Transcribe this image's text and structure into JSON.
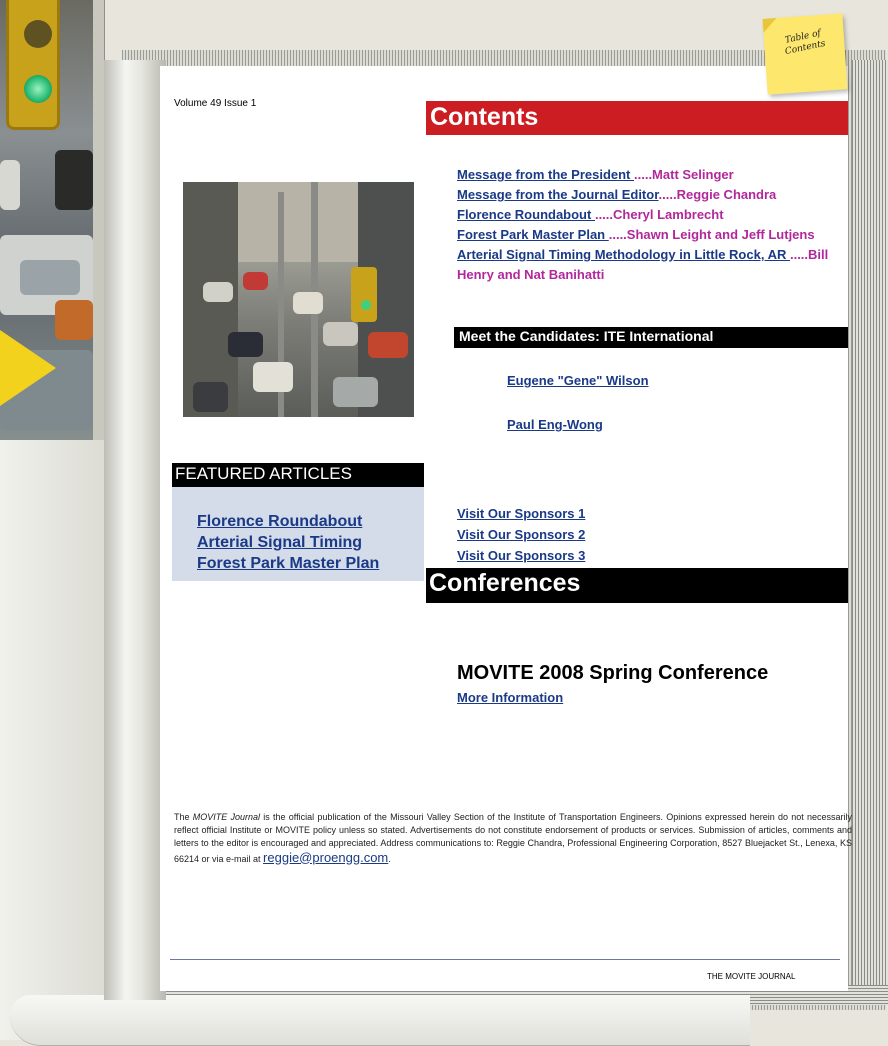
{
  "sticky_note": {
    "text": "Table of Contents"
  },
  "volume": "Volume 49 Issue 1",
  "contents_title": "Contents",
  "toc": [
    {
      "title": "Message from the President ",
      "author": ".....Matt Selinger"
    },
    {
      "title": "Message from the Journal Editor",
      "author": ".....Reggie Chandra"
    },
    {
      "title": "Florence Roundabout ",
      "author": ".....Cheryl Lambrecht"
    },
    {
      "title": "Forest Park Master Plan ",
      "author": ".....Shawn Leight and Jeff Lutjens"
    },
    {
      "title": "Arterial Signal Timing Methodology in Little Rock, AR ",
      "author": ".....Bill Henry and Nat Banihatti"
    }
  ],
  "candidates": {
    "title": "Meet the Candidates: ITE International",
    "names": [
      "Eugene \"Gene\" Wilson",
      "Paul Eng-Wong"
    ]
  },
  "featured": {
    "title": "FEATURED ARTICLES",
    "items": [
      "Florence Roundabout",
      "Arterial Signal Timing",
      "Forest Park Master Plan"
    ]
  },
  "sponsors": [
    "Visit Our Sponsors 1",
    "Visit Our Sponsors 2",
    "Visit Our Sponsors 3"
  ],
  "conferences": {
    "title": "Conferences",
    "event": "MOVITE 2008 Spring Conference",
    "more_info": "More Information"
  },
  "footer": {
    "journal_italic": "MOVITE Journal",
    "text_before": "The ",
    "text_after": " is the official publication of the Missouri Valley Section of the Institute of Transportation Engineers.  Opinions expressed herein do not necessarily reflect official Institute or MOVITE policy unless so stated.  Advertisements do not constitute endorsement of products or services.  Submission of articles, comments and letters to the editor is encouraged and appreciated.  Address communications to:  Reggie Chandra, Professional Engineering Corporation, 8527 Bluejacket St., Lenexa, KS 66214 or via e-mail at ",
    "email": "reggie@proengg.com",
    "end": ".",
    "journal_name": "THE MOVITE JOURNAL"
  },
  "colors": {
    "contents_bar": "#cc1e22",
    "link_blue": "#1a3a87",
    "author_magenta": "#b2279b",
    "featured_box": "#d4dcea"
  }
}
